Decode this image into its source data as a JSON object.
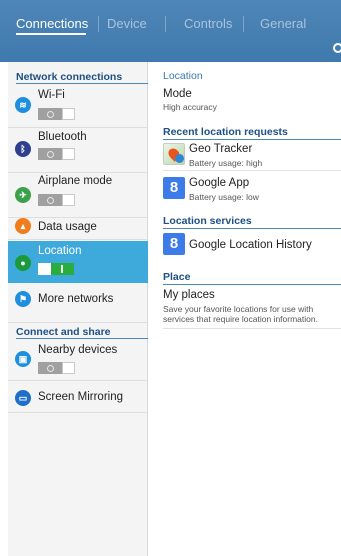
{
  "tabs": [
    {
      "label": "Connections",
      "active": true
    },
    {
      "label": "Device",
      "active": false
    },
    {
      "label": "Controls",
      "active": false
    },
    {
      "label": "General",
      "active": false
    }
  ],
  "colors": {
    "header": "#4376aa",
    "accent": "#3eaadb",
    "toggle_on": "#2aac3f"
  },
  "sidebar": {
    "network_heading": "Network connections",
    "share_heading": "Connect and share",
    "items": [
      {
        "label": "Wi-Fi",
        "icon": "wifi-icon",
        "toggle": "off"
      },
      {
        "label": "Bluetooth",
        "icon": "bluetooth-icon",
        "toggle": "off"
      },
      {
        "label": "Airplane mode",
        "icon": "airplane-icon",
        "toggle": "off"
      },
      {
        "label": "Data usage",
        "icon": "data-usage-icon"
      },
      {
        "label": "Location",
        "icon": "location-icon",
        "toggle": "on",
        "selected": true
      },
      {
        "label": "More networks",
        "icon": "more-networks-icon"
      },
      {
        "label": "Nearby devices",
        "icon": "nearby-devices-icon",
        "toggle": "off"
      },
      {
        "label": "Screen Mirroring",
        "icon": "screen-mirroring-icon"
      }
    ]
  },
  "main": {
    "title": "Location",
    "mode": {
      "label": "Mode",
      "value": "High accuracy"
    },
    "recent_heading": "Recent location requests",
    "recent": [
      {
        "name": "Geo Tracker",
        "usage": "Battery usage: high",
        "icon": "geo-tracker-icon"
      },
      {
        "name": "Google App",
        "usage": "Battery usage: low",
        "icon": "google-app-icon"
      }
    ],
    "services_heading": "Location services",
    "services": [
      {
        "name": "Google Location History",
        "icon": "google-location-history-icon"
      }
    ],
    "place_heading": "Place",
    "place": {
      "title": "My places",
      "desc_line1": "Save your favorite locations for use with",
      "desc_line2": "services that require location information."
    }
  }
}
